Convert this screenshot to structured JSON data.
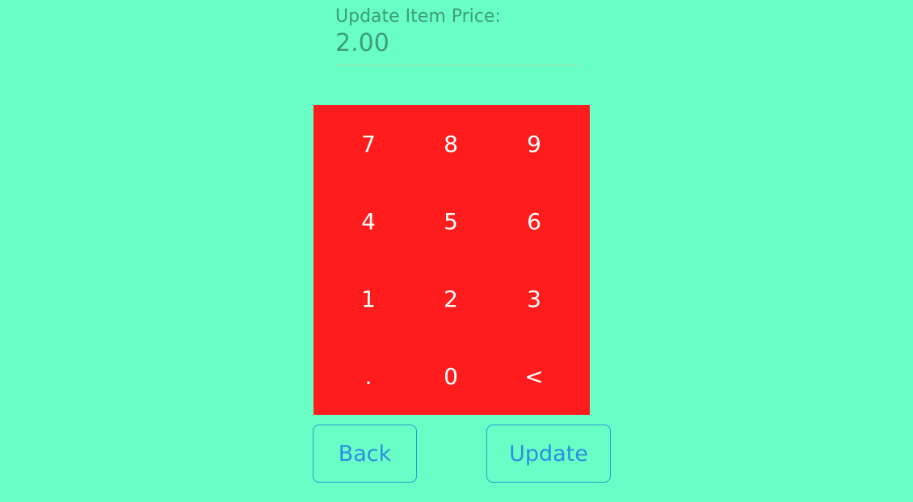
{
  "form": {
    "label": "Update Item Price:",
    "price_value": "2.00"
  },
  "keypad": {
    "keys": [
      "7",
      "8",
      "9",
      "4",
      "5",
      "6",
      "1",
      "2",
      "3",
      ".",
      "0",
      "<"
    ]
  },
  "actions": {
    "back_label": "Back",
    "update_label": "Update"
  },
  "colors": {
    "background": "#68fec6",
    "keypad": "#ff1c1c",
    "button_text": "#2c8ee0",
    "label_text": "#3d9e79"
  }
}
